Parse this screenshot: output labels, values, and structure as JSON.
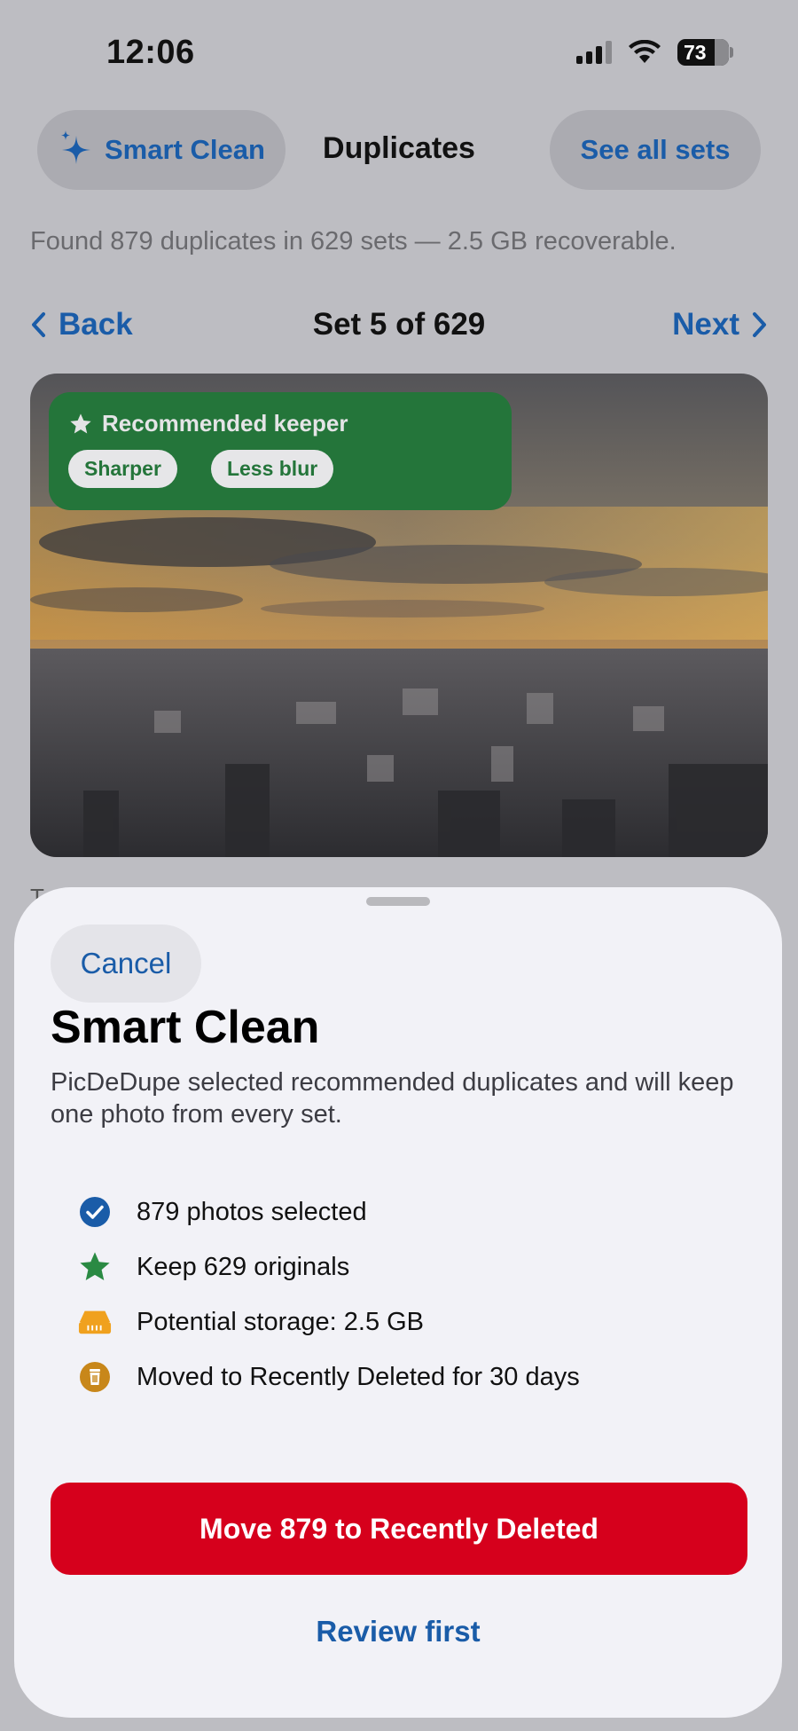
{
  "status_bar": {
    "time": "12:06",
    "battery": "73"
  },
  "header": {
    "smart_clean_label": "Smart Clean",
    "title": "Duplicates",
    "see_all_label": "See all sets",
    "summary": "Found 879 duplicates in 629 sets — 2.5 GB recoverable."
  },
  "set_nav": {
    "back_label": "Back",
    "set_label": "Set 5 of 629",
    "next_label": "Next"
  },
  "photo": {
    "keeper_label": "Recommended keeper",
    "tags": [
      "Sharper",
      "Less blur"
    ],
    "partial_caption": "T"
  },
  "sheet": {
    "cancel_label": "Cancel",
    "title": "Smart Clean",
    "description": "PicDeDupe selected recommended duplicates and will keep one photo from every set.",
    "facts": [
      {
        "icon": "checkmark-circle-icon",
        "text": "879 photos selected"
      },
      {
        "icon": "star-icon",
        "text": "Keep 629 originals"
      },
      {
        "icon": "storage-icon",
        "text": "Potential storage: 2.5 GB"
      },
      {
        "icon": "trash-icon",
        "text": "Moved to Recently Deleted for 30 days"
      }
    ],
    "primary_label": "Move 879 to Recently Deleted",
    "secondary_label": "Review first"
  },
  "colors": {
    "accent": "#1a5ca8",
    "keeper_green": "#24753a",
    "destructive": "#d6001c"
  }
}
